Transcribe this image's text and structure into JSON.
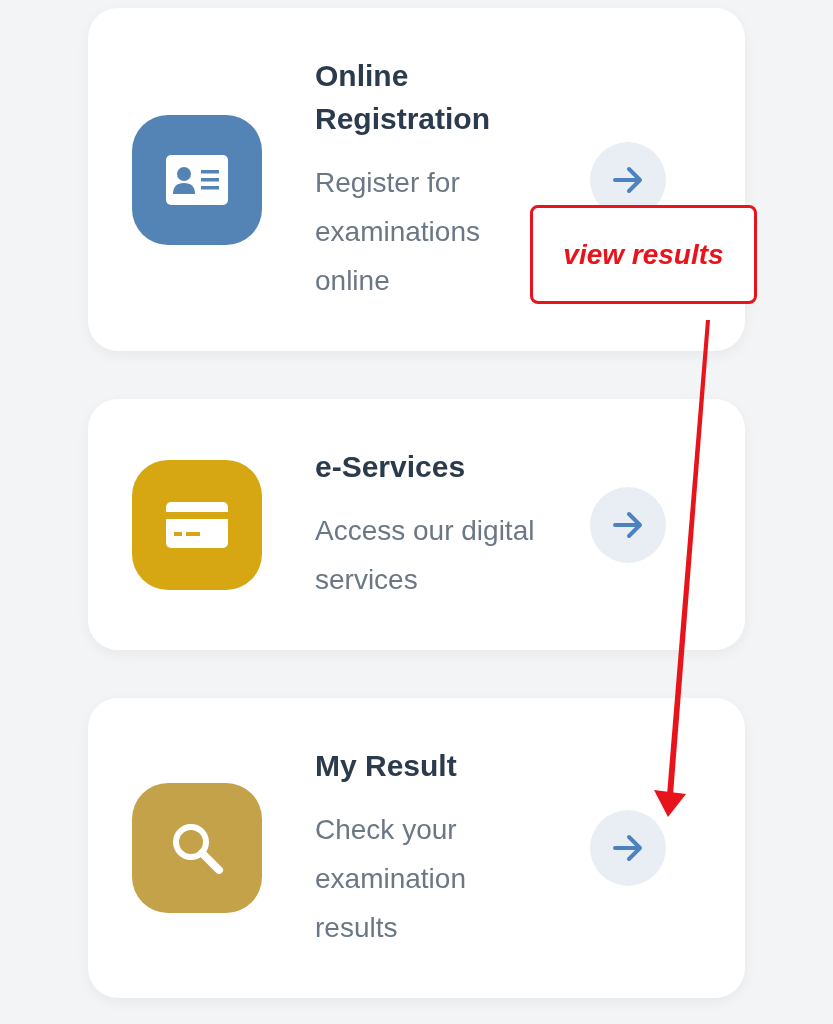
{
  "cards": [
    {
      "title": "Online Registration",
      "description": "Register for examinations online",
      "kind": "id-card",
      "color": "#5483b5"
    },
    {
      "title": "e-Services",
      "description": "Access our digital services",
      "kind": "credit-card",
      "color": "#d6a713"
    },
    {
      "title": "My Result",
      "description": "Check your examination results",
      "kind": "search",
      "color": "#c4a24a"
    }
  ],
  "annotation": {
    "label": "view results"
  }
}
